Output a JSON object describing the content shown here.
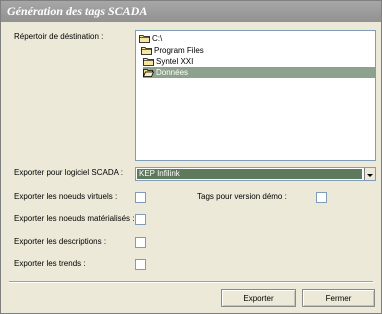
{
  "window": {
    "title": "Génération des tags SCADA"
  },
  "destination": {
    "label": "Répertoir de déstination :",
    "tree": [
      {
        "label": "C:\\",
        "selected": false
      },
      {
        "label": "Program Files",
        "selected": false
      },
      {
        "label": "Syntel XXI",
        "selected": false
      },
      {
        "label": "Données",
        "selected": true
      }
    ]
  },
  "scada": {
    "label": "Exporter pour logiciel SCADA :",
    "value": "KEP Infilink"
  },
  "options": {
    "virtual_nodes": "Exporter les noeuds virtuels :",
    "demo_tags": "Tags pour version démo :",
    "material_nodes": "Exporter les noeuds matérialisés :",
    "descriptions": "Exporter les descriptions :",
    "trends": "Exporter les trends :"
  },
  "buttons": {
    "export": "Exporter",
    "close": "Fermer"
  }
}
